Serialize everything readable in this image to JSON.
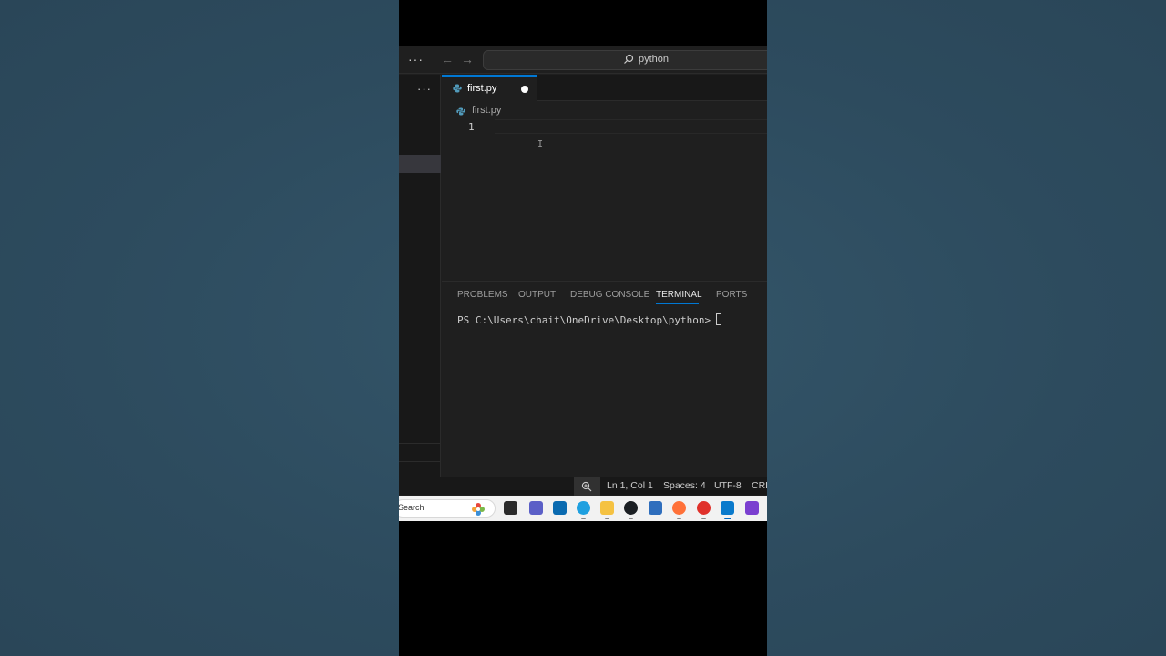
{
  "titlebar": {
    "more_icon": "ellipsis-icon",
    "back_icon": "arrow-left-icon",
    "forward_icon": "arrow-right-icon",
    "search_icon": "search-icon",
    "search_text": "python"
  },
  "sidebar": {
    "more_icon": "ellipsis-icon"
  },
  "editor_tab": {
    "label": "first.py",
    "icon": "python-file-icon",
    "modified_indicator": "dot-icon"
  },
  "breadcrumb": {
    "label": "first.py",
    "icon": "python-file-icon"
  },
  "editor": {
    "line_numbers": [
      "1"
    ],
    "cursor_glyph": "I"
  },
  "panel": {
    "tabs": [
      "PROBLEMS",
      "OUTPUT",
      "DEBUG CONSOLE",
      "TERMINAL",
      "PORTS"
    ],
    "active_tab": "TERMINAL",
    "terminal_prompt": "PS C:\\Users\\chait\\OneDrive\\Desktop\\python>"
  },
  "statusbar": {
    "zoom_icon": "zoom-in-icon",
    "position": "Ln 1, Col 1",
    "indentation": "Spaces: 4",
    "encoding": "UTF-8",
    "eol": "CRL"
  },
  "taskbar": {
    "search_text": "Search",
    "apps": [
      {
        "name": "task-view-icon",
        "color": "#2b2b2b"
      },
      {
        "name": "teams-icon",
        "color": "#5b5fc7"
      },
      {
        "name": "dell-icon",
        "color": "#0a6ab0"
      },
      {
        "name": "edge-icon",
        "color": "#1fa0e0"
      },
      {
        "name": "file-explorer-icon",
        "color": "#f5c242"
      },
      {
        "name": "github-desktop-icon",
        "color": "#1b1f23"
      },
      {
        "name": "microsoft-store-icon",
        "color": "#2f6ebd"
      },
      {
        "name": "firefox-icon",
        "color": "#ff7139"
      },
      {
        "name": "wps-office-icon",
        "color": "#e0312b"
      },
      {
        "name": "vscode-icon",
        "color": "#0a7acc"
      },
      {
        "name": "clipchamp-icon",
        "color": "#7b3fd0"
      }
    ]
  },
  "colors": {
    "accent": "#0078d4",
    "editor_bg": "#1f1f1f",
    "page_bg": "#2d4b5e"
  }
}
